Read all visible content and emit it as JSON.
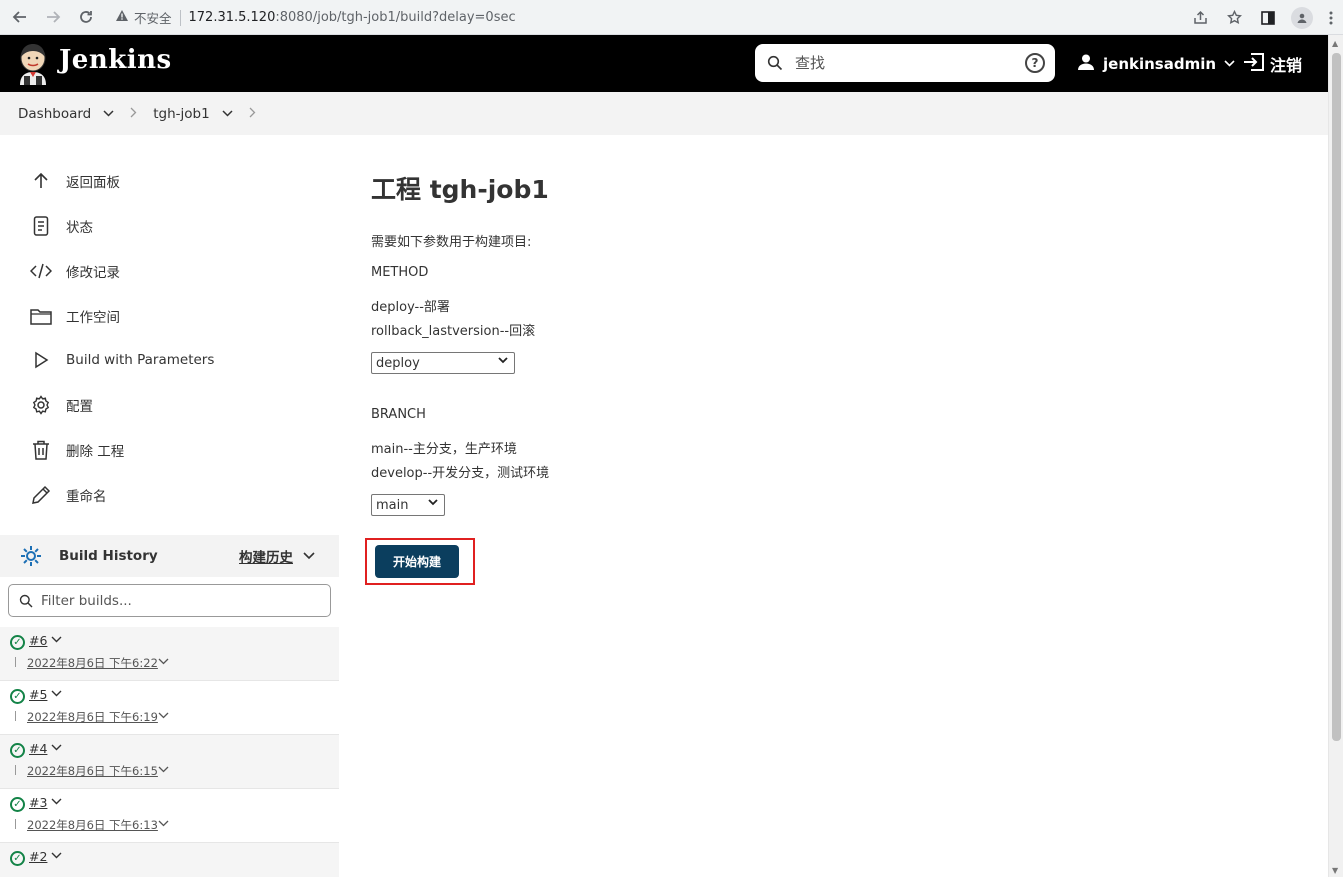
{
  "browser": {
    "insecure_label": "不安全",
    "url_host": "172.31.5.120",
    "url_path": ":8080/job/tgh-job1/build?delay=0sec"
  },
  "header": {
    "brand": "Jenkins",
    "search_placeholder": "查找",
    "help_label": "?",
    "username": "jenkinsadmin",
    "logout_label": "注销"
  },
  "breadcrumb": {
    "items": [
      "Dashboard",
      "tgh-job1"
    ]
  },
  "sidebar": {
    "tasks": [
      {
        "label": "返回面板",
        "icon": "arrow-up-icon"
      },
      {
        "label": "状态",
        "icon": "document-icon"
      },
      {
        "label": "修改记录",
        "icon": "code-icon"
      },
      {
        "label": "工作空间",
        "icon": "folder-icon"
      },
      {
        "label": "Build with Parameters",
        "icon": "play-icon"
      },
      {
        "label": "配置",
        "icon": "gear-icon"
      },
      {
        "label": "删除 工程",
        "icon": "trash-icon"
      },
      {
        "label": "重命名",
        "icon": "pencil-icon"
      }
    ],
    "build_history": {
      "title": "Build History",
      "trend_label": "构建历史",
      "filter_placeholder": "Filter builds...",
      "builds": [
        {
          "number": "#6",
          "date": "2022年8月6日 下午6:22",
          "status": "success"
        },
        {
          "number": "#5",
          "date": "2022年8月6日 下午6:19",
          "status": "success"
        },
        {
          "number": "#4",
          "date": "2022年8月6日 下午6:15",
          "status": "success"
        },
        {
          "number": "#3",
          "date": "2022年8月6日 下午6:13",
          "status": "success"
        },
        {
          "number": "#2",
          "date": "",
          "status": "success"
        }
      ]
    }
  },
  "main": {
    "title": "工程 tgh-job1",
    "intro": "需要如下参数用于构建项目:",
    "params": [
      {
        "name": "METHOD",
        "desc_lines": [
          "deploy--部署",
          "rollback_lastversion--回滚"
        ],
        "selected": "deploy"
      },
      {
        "name": "BRANCH",
        "desc_lines": [
          "main--主分支，生产环境",
          "develop--开发分支，测试环境"
        ],
        "selected": "main"
      }
    ],
    "build_button": "开始构建"
  },
  "colors": {
    "header_bg": "#000000",
    "build_button_bg": "#0b3e5e",
    "highlight_frame": "#e02020",
    "success_green": "#138347"
  }
}
